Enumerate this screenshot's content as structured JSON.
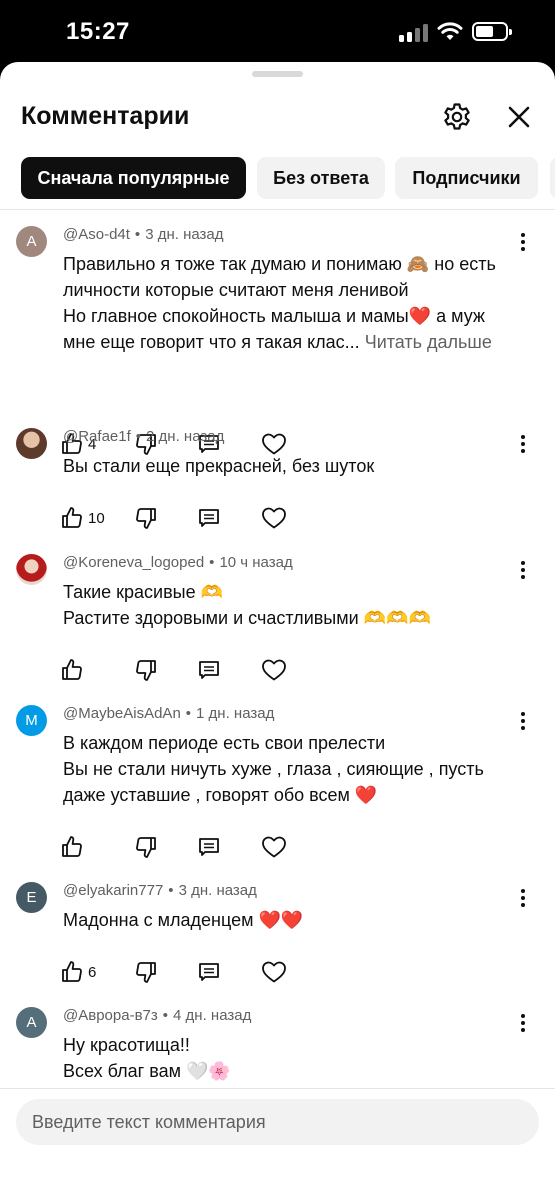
{
  "status_bar": {
    "time": "15:27"
  },
  "header": {
    "title": "Комментарии"
  },
  "filters": [
    {
      "label": "Сначала популярные",
      "active": true
    },
    {
      "label": "Без ответа",
      "active": false
    },
    {
      "label": "Подписчики",
      "active": false
    },
    {
      "label": "",
      "active": false
    }
  ],
  "comments": [
    {
      "author": "@Aso-d4t",
      "time": "3 дн. назад",
      "avatar_letter": "A",
      "avatar_color": "#a1887f",
      "lines": [
        "Правильно я тоже так думаю и понимаю 🙈 но есть",
        "личности которые считают меня ленивой",
        "Но главное спокойность малыша и мамы❤️ а муж",
        "мне еще говорит что я такая клас..."
      ],
      "read_more": "Читать дальше",
      "likes": "4"
    },
    {
      "author": "@Rafae1f",
      "time": "2 дн. назад",
      "avatar_letter": "",
      "avatar_color": "#8d6e63",
      "lines": [
        "Вы стали еще прекрасней, без шуток"
      ],
      "read_more": "",
      "likes": "10"
    },
    {
      "author": "@Koreneva_logoped",
      "time": "10 ч назад",
      "avatar_letter": "",
      "avatar_color": "#b71c1c",
      "lines": [
        "Такие красивые 🫶",
        "Растите здоровыми и счастливыми 🫶🫶🫶"
      ],
      "read_more": "",
      "likes": ""
    },
    {
      "author": "@MaybeAisAdAn",
      "time": "1 дн. назад",
      "avatar_letter": "M",
      "avatar_color": "#039be5",
      "lines": [
        "В каждом периоде есть свои прелести",
        "Вы не стали ничуть хуже , глаза , сияющие , пусть",
        "даже уставшие , говорят обо всем ❤️"
      ],
      "read_more": "",
      "likes": ""
    },
    {
      "author": "@elyakarin777",
      "time": "3 дн. назад",
      "avatar_letter": "E",
      "avatar_color": "#455a64",
      "lines": [
        "Мадонна с младенцем ❤️❤️"
      ],
      "read_more": "",
      "likes": "6"
    },
    {
      "author": "@Аврора-в7з",
      "time": "4 дн. назад",
      "avatar_letter": "A",
      "avatar_color": "#546e7a",
      "lines": [
        "Ну красотища!!",
        "Всех благ вам 🤍🌸"
      ],
      "read_more": "",
      "likes": ""
    }
  ],
  "input": {
    "placeholder": "Введите текст комментария"
  }
}
